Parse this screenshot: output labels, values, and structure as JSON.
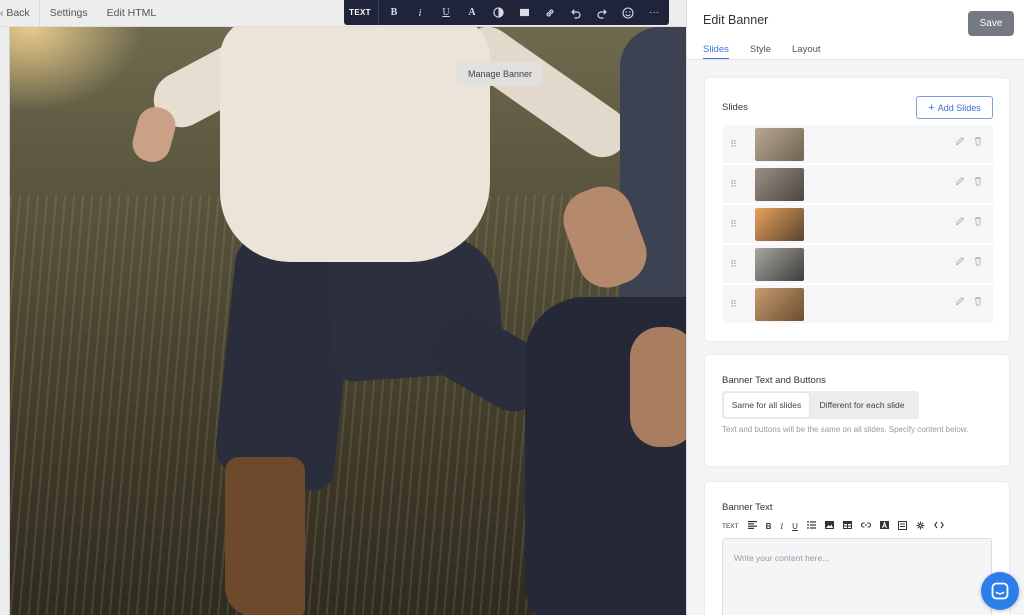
{
  "topbar": {
    "back_label": "Back",
    "settings_label": "Settings",
    "edit_html_label": "Edit HTML"
  },
  "format_toolbar": {
    "text_label": "TEXT",
    "bold_label": "B",
    "italic_label": "i",
    "underline_label": "U",
    "font_color_label": "A",
    "more_label": "···"
  },
  "canvas": {
    "manage_banner_label": "Manage Banner"
  },
  "panel": {
    "title": "Edit Banner",
    "save_label": "Save",
    "tabs": [
      {
        "label": "Slides"
      },
      {
        "label": "Style"
      },
      {
        "label": "Layout"
      }
    ],
    "active_tab": "Slides",
    "accent_color": "#3d78d8",
    "slides_card": {
      "label": "Slides",
      "add_label": "Add Slides",
      "add_icon": "plus-icon",
      "slides": [
        {
          "thumb_colors": [
            "#b9a892",
            "#6e6452"
          ]
        },
        {
          "thumb_colors": [
            "#9a9084",
            "#4b4542"
          ]
        },
        {
          "thumb_colors": [
            "#e8a25a",
            "#5a4330"
          ]
        },
        {
          "thumb_colors": [
            "#a8a6a0",
            "#3f3d3a"
          ]
        },
        {
          "thumb_colors": [
            "#c89c6e",
            "#6a4d32"
          ]
        }
      ]
    },
    "banner_text_buttons": {
      "label": "Banner Text and Buttons",
      "options": [
        "Same for all slides",
        "Different for each slide"
      ],
      "selected": "Same for all slides",
      "help": "Text and buttons will be the same on all slides. Specify content below."
    },
    "banner_text": {
      "label": "Banner Text",
      "toolbar_text_label": "TEXT",
      "toolbar_bold": "B",
      "toolbar_italic": "I",
      "toolbar_underline": "U",
      "placeholder": "Write your content here..."
    }
  }
}
